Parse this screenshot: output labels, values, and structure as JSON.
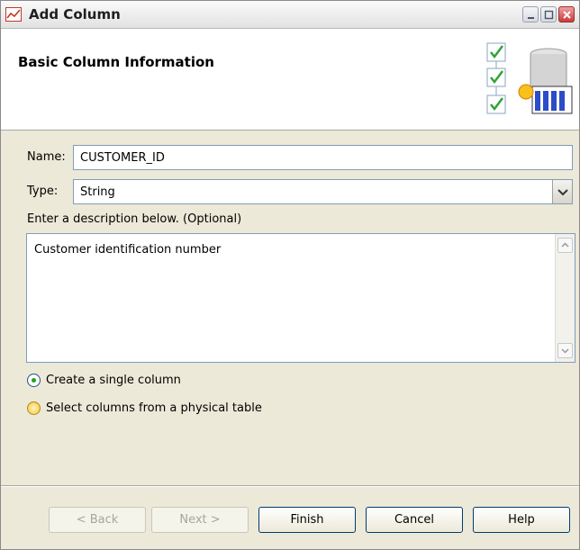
{
  "window": {
    "title": "Add Column"
  },
  "header": {
    "title": "Basic Column Information"
  },
  "form": {
    "name_label": "Name:",
    "name_value": "CUSTOMER_ID",
    "type_label": "Type:",
    "type_value": "String",
    "description_prompt": "Enter a description below. (Optional)",
    "description_value": "Customer identification number"
  },
  "options": {
    "single_column": "Create a single column",
    "physical_table": "Select columns from a physical table"
  },
  "buttons": {
    "back": "< Back",
    "next": "Next >",
    "finish": "Finish",
    "cancel": "Cancel",
    "help": "Help"
  },
  "colors": {
    "accent": "#003c74",
    "check": "#21a121",
    "frame": "#ece9d8"
  }
}
